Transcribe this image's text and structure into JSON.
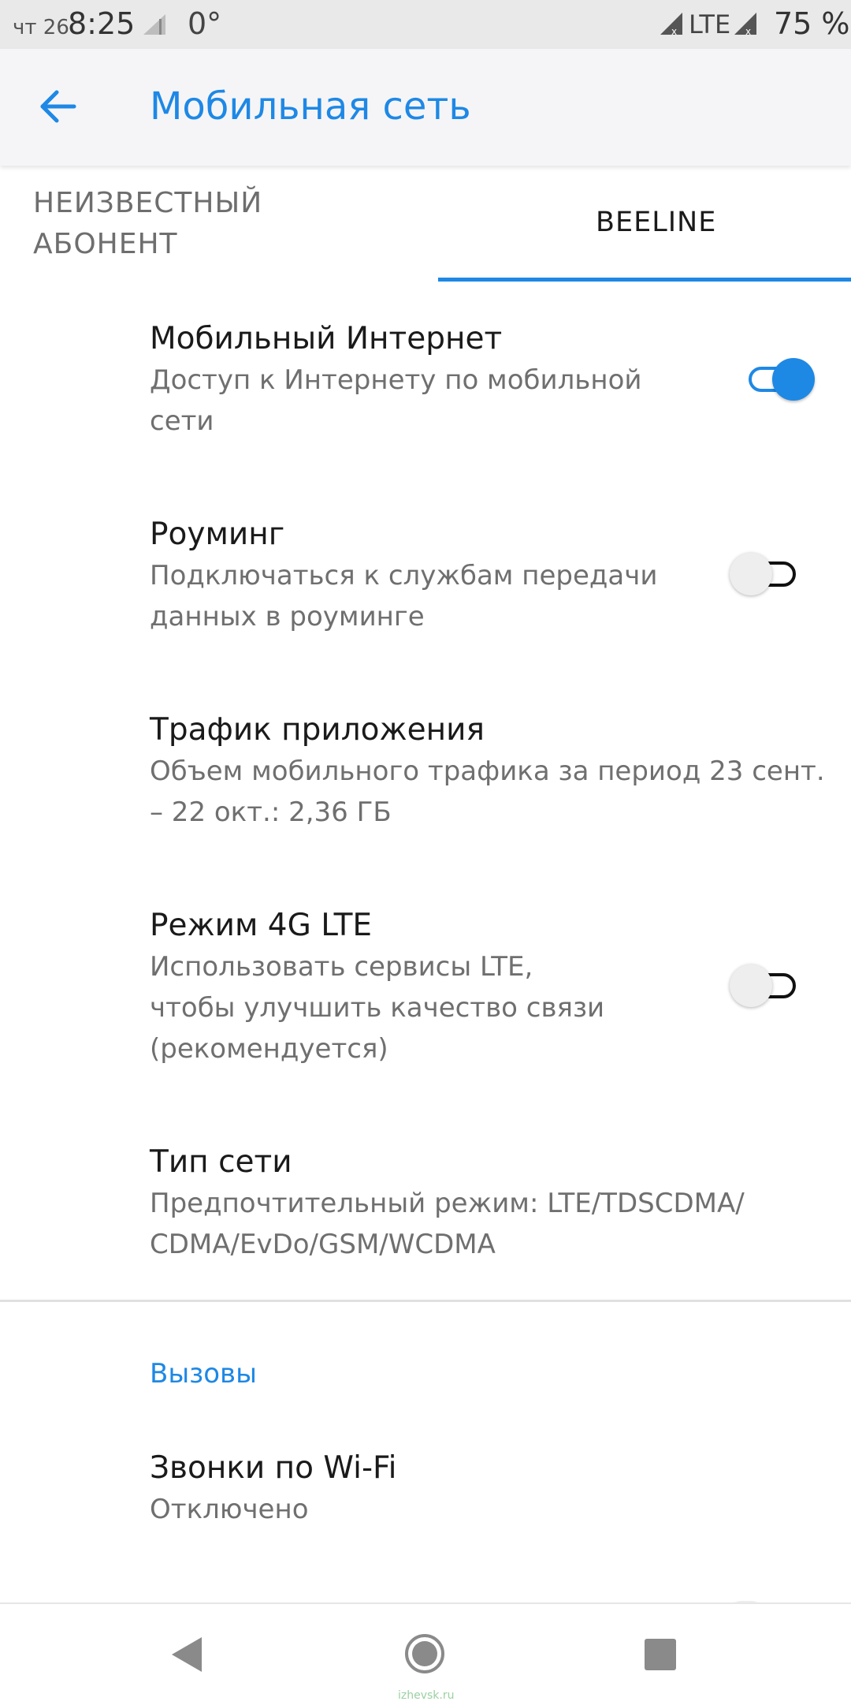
{
  "status_bar": {
    "day": "чт 26",
    "time": "8:25",
    "temperature": "0°",
    "network": "LTE",
    "battery": "75 %"
  },
  "app_bar": {
    "back_icon": "arrow-back-icon",
    "title": "Мобильная сеть"
  },
  "tabs": [
    {
      "label_line1": "НЕИЗВЕСТНЫЙ",
      "label_line2": "АБОНЕНТ",
      "selected": false
    },
    {
      "label": "BEELINE",
      "selected": true
    }
  ],
  "settings": {
    "mobile_internet": {
      "title": "Мобильный Интернет",
      "summary_line1": "Доступ к Интернету по мобильной",
      "summary_line2": "сети",
      "enabled": true
    },
    "roaming": {
      "title": "Роуминг",
      "summary_line1": "Подключаться к службам передачи",
      "summary_line2": "данных в роуминге",
      "enabled": false
    },
    "app_traffic": {
      "title": "Трафик приложения",
      "summary_line1": "Объем мобильного трафика за период 23 сент.",
      "summary_line2": "– 22 окт.: 2,36 ГБ"
    },
    "lte_mode": {
      "title": "Режим 4G LTE",
      "summary_line1": "Использовать сервисы LTE,",
      "summary_line2": "чтобы улучшить качество связи",
      "summary_line3": "(рекомендуется)",
      "enabled": false
    },
    "network_type": {
      "title": "Тип сети",
      "summary_line1": "Предпочтительный режим: LTE/TDSCDMA/",
      "summary_line2": "CDMA/EvDo/GSM/WCDMA"
    }
  },
  "calls_section": {
    "header": "Вызовы",
    "wifi_calling": {
      "title": "Звонки по Wi-Fi",
      "summary": "Отключено"
    }
  },
  "nav_bar": {
    "back_icon": "nav-back-triangle-icon",
    "home_icon": "nav-home-circle-icon",
    "recents_icon": "nav-recents-square-icon",
    "watermark": "izhevsk.ru"
  },
  "colors": {
    "accent": "#1e88e5",
    "app_bar_bg": "#f5f5f7",
    "status_bar_bg": "#e9e9e9"
  }
}
